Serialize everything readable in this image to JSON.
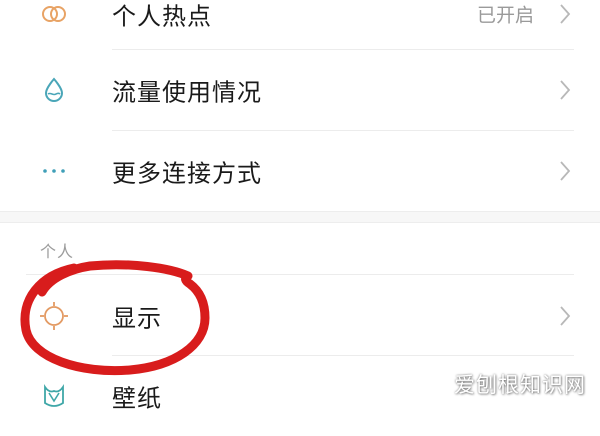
{
  "network": {
    "items": [
      {
        "label": "个人热点",
        "value": "已开启",
        "icon": "hotspot-icon"
      },
      {
        "label": "流量使用情况",
        "value": "",
        "icon": "data-usage-icon"
      },
      {
        "label": "更多连接方式",
        "value": "",
        "icon": "more-dots-icon"
      }
    ]
  },
  "personal": {
    "header": "个人",
    "items": [
      {
        "label": "显示",
        "icon": "display-sun-icon"
      },
      {
        "label": "壁纸",
        "icon": "wallpaper-icon"
      }
    ]
  },
  "colors": {
    "hotspot_icon": "#e8a365",
    "data_usage_icon": "#4aa6b8",
    "more_dots_icon": "#3f9fb8",
    "display_icon": "#e39a63",
    "wallpaper_icon": "#3fa7a8",
    "annotation_red": "#d81c1c"
  },
  "watermark": "爱刨根知识网"
}
